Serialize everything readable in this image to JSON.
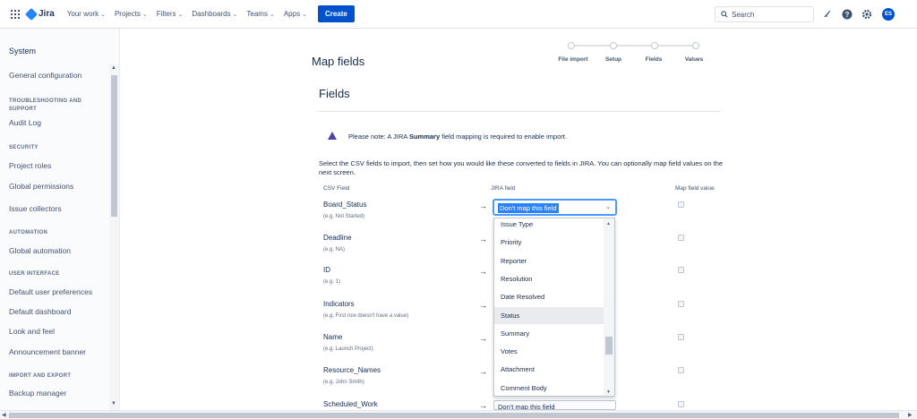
{
  "topnav": {
    "logo": "Jira",
    "items": [
      "Your work",
      "Projects",
      "Filters",
      "Dashboards",
      "Teams",
      "Apps"
    ],
    "create": "Create",
    "search_placeholder": "Search",
    "avatar_initials": "ES"
  },
  "sidebar": {
    "title": "System",
    "entries": [
      {
        "kind": "item",
        "text": "General configuration"
      },
      {
        "kind": "head",
        "text": "TROUBLESHOOTING AND SUPPORT"
      },
      {
        "kind": "item",
        "text": "Audit Log"
      },
      {
        "kind": "head",
        "text": "SECURITY"
      },
      {
        "kind": "item",
        "text": "Project roles"
      },
      {
        "kind": "item",
        "text": "Global permissions"
      },
      {
        "kind": "item",
        "text": "Issue collectors"
      },
      {
        "kind": "head",
        "text": "AUTOMATION"
      },
      {
        "kind": "item",
        "text": "Global automation"
      },
      {
        "kind": "head",
        "text": "USER INTERFACE"
      },
      {
        "kind": "item",
        "text": "Default user preferences"
      },
      {
        "kind": "item",
        "text": "Default dashboard"
      },
      {
        "kind": "item",
        "text": "Look and feel"
      },
      {
        "kind": "item",
        "text": "Announcement banner"
      },
      {
        "kind": "head",
        "text": "IMPORT AND EXPORT"
      },
      {
        "kind": "item",
        "text": "Backup manager"
      }
    ]
  },
  "main": {
    "page_title": "Map fields",
    "steps": [
      "File import",
      "Setup",
      "Fields",
      "Values"
    ],
    "section_title": "Fields",
    "note_prefix": "Please note: A JIRA ",
    "note_bold": "Summary",
    "note_suffix": " field mapping is required to enable import.",
    "intro": "Select the CSV fields to import, then set how you would like these converted to fields in JIRA. You can optionally map field values on the next screen.",
    "columns": {
      "csv": "CSV Field",
      "jira": "JIRA field",
      "map": "Map field value"
    },
    "arrow": "→",
    "rows": [
      {
        "name": "Board_Status",
        "example": "(e.g. Not Started)"
      },
      {
        "name": "Deadline",
        "example": "(e.g. NA)"
      },
      {
        "name": "ID",
        "example": "(e.g. 1)"
      },
      {
        "name": "Indicators",
        "example": "(e.g. First row doesn't have a value)"
      },
      {
        "name": "Name",
        "example": "(e.g. Launch Project)"
      },
      {
        "name": "Resource_Names",
        "example": "(e.g. John Smith)"
      },
      {
        "name": "Scheduled_Work",
        "example": ""
      }
    ],
    "selected_value": "Don't map this field",
    "last_row_value": "Don't map this field",
    "dropdown_options": [
      "Issue Type",
      "Priority",
      "Reporter",
      "Resolution",
      "Date Resolved",
      "Status",
      "Summary",
      "Votes",
      "Attachment",
      "Comment Body"
    ],
    "highlighted_option": "Status"
  }
}
